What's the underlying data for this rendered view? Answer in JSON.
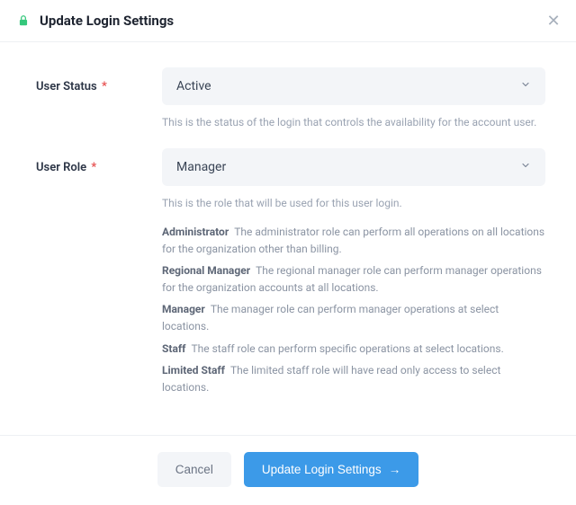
{
  "header": {
    "title": "Update Login Settings"
  },
  "fields": {
    "status": {
      "label": "User Status",
      "required_marker": "*",
      "value": "Active",
      "hint": "This is the status of the login that controls the availability for the account user."
    },
    "role": {
      "label": "User Role",
      "required_marker": "*",
      "value": "Manager",
      "hint": "This is the role that will be used for this user login."
    }
  },
  "roles": [
    {
      "name": "Administrator",
      "desc": "The administrator role can perform all operations on all locations for the organization other than billing."
    },
    {
      "name": "Regional Manager",
      "desc": "The regional manager role can perform manager operations for the organization accounts at all locations."
    },
    {
      "name": "Manager",
      "desc": "The manager role can perform manager operations at select locations."
    },
    {
      "name": "Staff",
      "desc": "The staff role can perform specific operations at select locations."
    },
    {
      "name": "Limited Staff",
      "desc": "The limited staff role will have read only access to select locations."
    }
  ],
  "footer": {
    "cancel": "Cancel",
    "submit": "Update Login Settings"
  },
  "colors": {
    "primary": "#3c9ae8",
    "accent_green": "#34c77b"
  }
}
